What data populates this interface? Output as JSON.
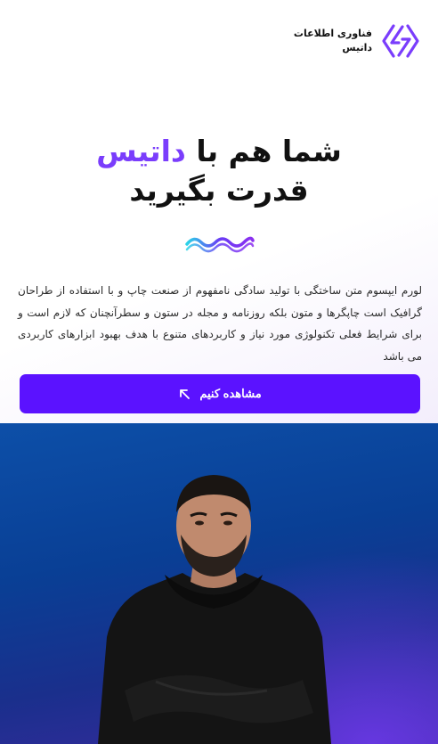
{
  "header": {
    "brand_line1": "فناوری اطلاعات",
    "brand_line2": "داتیس",
    "logo_icon": "datis-logo-icon",
    "accent_color": "#7a3dfc"
  },
  "hero": {
    "title_part1": "شما هم با",
    "title_accent": "داتیس",
    "title_line2": "قدرت بگیرید",
    "description": "لورم ایپسوم متن ساختگی با تولید سادگی نامفهوم از صنعت چاپ و با استفاده از طراحان گرافیک است چاپگرها و متون بلکه روزنامه و مجله در ستون و سطرآنچنان که لازم است و برای شرایط فعلی تکنولوژی مورد نیاز و کاربردهای متنوع با هدف بهبود ابزارهای کاربردی می باشد",
    "cta_label": "مشاهده کنیم",
    "cta_icon": "arrow-up-left-icon",
    "cta_color": "#5b12ff"
  },
  "photo": {
    "alt": "person-photo",
    "bg_color": "#0d4fa8"
  }
}
